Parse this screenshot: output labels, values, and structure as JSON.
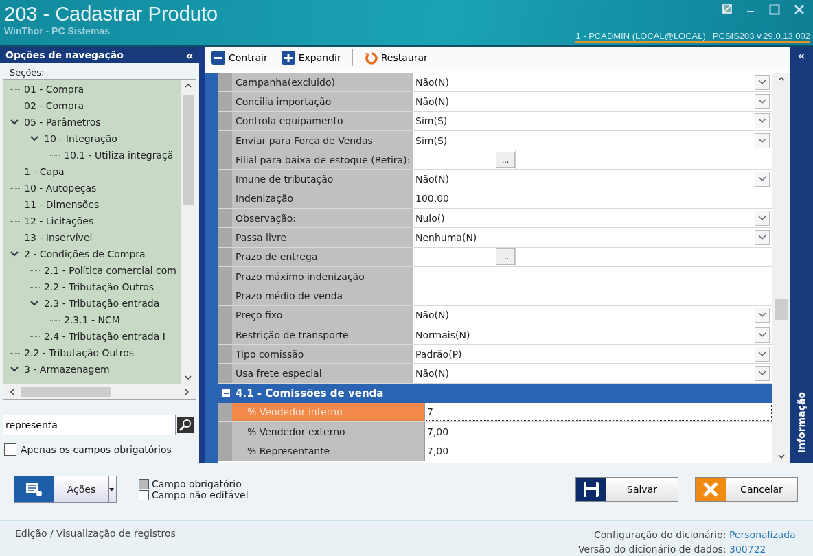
{
  "window": {
    "title": "203 - Cadastrar  Produto",
    "subtitle": "WinThor - PC Sistemas",
    "session": "1 - PCADMIN (LOCAL@LOCAL)",
    "version": "PCSIS203  v.29.0.13.002"
  },
  "navigation": {
    "title": "Opções de navegação",
    "collapse": "«",
    "sections_label": "Seções:",
    "tree": [
      {
        "label": "01 - Compra"
      },
      {
        "label": "02 - Compra"
      },
      {
        "label": "05 - Parâmetros",
        "expanded": true,
        "children": [
          {
            "label": "10 - Integração",
            "expanded": true,
            "children": [
              {
                "label": "10.1 - Utiliza integraçã"
              }
            ]
          }
        ]
      },
      {
        "label": "1 - Capa"
      },
      {
        "label": "10 - Autopeças"
      },
      {
        "label": "11 - Dimensões"
      },
      {
        "label": "12 - Licitações"
      },
      {
        "label": "13 - Inservível"
      },
      {
        "label": "2 - Condições de Compra",
        "expanded": true,
        "children": [
          {
            "label": "2.1 - Política comercial com"
          },
          {
            "label": "2.2 - Tributação Outros"
          },
          {
            "label": "2.3 - Tributação entrada",
            "expanded": true,
            "children": [
              {
                "label": "2.3.1 - NCM"
              }
            ]
          },
          {
            "label": "2.4 - Tributação entrada I"
          }
        ]
      },
      {
        "label": "2.2 - Tributação Outros"
      },
      {
        "label": "3 - Armazenagem",
        "expanded": true
      }
    ],
    "search": {
      "value": "representa"
    },
    "required_only": {
      "label": "Apenas os campos obrigatórios",
      "checked": false
    }
  },
  "toolbar": [
    {
      "label": "Contrair",
      "kind": "minus"
    },
    {
      "label": "Expandir",
      "kind": "plus"
    },
    {
      "label": "Restaurar",
      "kind": "restore"
    }
  ],
  "info_panel": {
    "collapse": "«",
    "label": "Informação"
  },
  "properties": [
    {
      "label": "Campanha(excluido)",
      "kind": "dropdown",
      "value": "Não(N)"
    },
    {
      "label": "Concilia importação",
      "kind": "dropdown",
      "value": "Não(N)"
    },
    {
      "label": "Controla equipamento",
      "kind": "dropdown",
      "value": "Sim(S)"
    },
    {
      "label": "Enviar para Força de Vendas",
      "kind": "dropdown",
      "value": "Sim(S)"
    },
    {
      "label": "Filial para baixa de estoque (Retira):",
      "kind": "lookup",
      "button": "..."
    },
    {
      "label": "Imune de tributação",
      "kind": "dropdown",
      "value": "Não(N)"
    },
    {
      "label": "Indenização",
      "kind": "text",
      "value": "100,00"
    },
    {
      "label": "Observação:",
      "kind": "dropdown",
      "value": "Nulo()"
    },
    {
      "label": "Passa livre",
      "kind": "dropdown",
      "value": "Nenhuma(N)"
    },
    {
      "label": "Prazo de entrega",
      "kind": "lookup",
      "button": "..."
    },
    {
      "label": "Prazo máximo indenização",
      "kind": "text"
    },
    {
      "label": "Prazo médio de venda",
      "kind": "text"
    },
    {
      "label": "Preço fixo",
      "kind": "dropdown",
      "value": "Não(N)"
    },
    {
      "label": "Restrição de transporte",
      "kind": "dropdown",
      "value": "Normais(N)"
    },
    {
      "label": "Tipo comissão",
      "kind": "dropdown",
      "value": "Padrão(P)"
    },
    {
      "label": "Usa frete especial",
      "kind": "dropdown",
      "value": "Não(N)"
    }
  ],
  "section": {
    "title": "4.1 - Comissões de venda",
    "expanded": true,
    "rows": [
      {
        "label": "% Vendedor interno",
        "value": "7",
        "selected": true
      },
      {
        "label": "% Vendedor externo",
        "value": "7,00",
        "selected": false
      },
      {
        "label": "% Representante",
        "value": "7,00",
        "selected": false
      }
    ]
  },
  "actions_button": "Ações",
  "legend": [
    {
      "label": "Campo obrigatório",
      "kind": "required"
    },
    {
      "label": "Campo não editável",
      "kind": "readonly"
    }
  ],
  "buttons": [
    {
      "label": "Salvar",
      "kind": "save"
    },
    {
      "label": "Cancelar",
      "kind": "cancel"
    }
  ],
  "status_bar": {
    "left": "Edição / Visualização de registros",
    "config_label": "Configuração do dicionário:",
    "config_value": "Personalizada",
    "version_label": "Versão do dicionário de dados:",
    "version_value": "300722"
  }
}
